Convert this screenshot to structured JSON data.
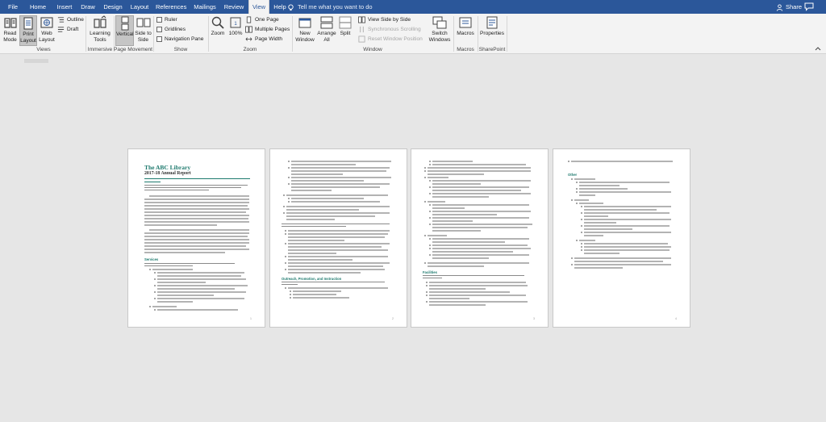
{
  "tabs": [
    {
      "label": "File",
      "active": false
    },
    {
      "label": "Home",
      "active": false
    },
    {
      "label": "Insert",
      "active": false
    },
    {
      "label": "Draw",
      "active": false
    },
    {
      "label": "Design",
      "active": false
    },
    {
      "label": "Layout",
      "active": false
    },
    {
      "label": "References",
      "active": false
    },
    {
      "label": "Mailings",
      "active": false
    },
    {
      "label": "Review",
      "active": false
    },
    {
      "label": "View",
      "active": true
    },
    {
      "label": "Help",
      "active": false
    }
  ],
  "tell_me": "Tell me what you want to do",
  "share_label": "Share",
  "ribbon": {
    "views": {
      "label": "Views",
      "read_mode": "Read Mode",
      "print_layout": "Print Layout",
      "web_layout": "Web Layout",
      "outline": "Outline",
      "draft": "Draft"
    },
    "immersive": {
      "label": "Immersive",
      "learning_tools": "Learning Tools"
    },
    "page_movement": {
      "label": "Page Movement",
      "vertical": "Vertical",
      "side_to_side": "Side to Side"
    },
    "show": {
      "label": "Show",
      "ruler": "Ruler",
      "gridlines": "Gridlines",
      "navigation_pane": "Navigation Pane"
    },
    "zoom": {
      "label": "Zoom",
      "zoom": "Zoom",
      "percent": "100%",
      "one_page": "One Page",
      "multiple_pages": "Multiple Pages",
      "page_width": "Page Width"
    },
    "window": {
      "label": "Window",
      "new_window": "New Window",
      "arrange_all": "Arrange All",
      "split": "Split",
      "view_side_by_side": "View Side by Side",
      "synchronous_scrolling": "Synchronous Scrolling",
      "reset_window_position": "Reset Window Position",
      "switch_windows": "Switch Windows"
    },
    "macros": {
      "label": "Macros",
      "macros": "Macros"
    },
    "sharepoint": {
      "label": "SharePoint",
      "properties": "Properties"
    }
  },
  "document": {
    "title": "The ABC Library",
    "subtitle": "2017-18 Annual Report",
    "section_services": "Services",
    "section_outreach": "Outreach, Promotion, and Instruction",
    "section_facilities": "Facilities",
    "section_other": "Other",
    "page_numbers": [
      "1",
      "2",
      "3",
      "4"
    ]
  },
  "colors": {
    "ribbon_blue": "#2b579a",
    "heading_teal": "#1e7a6e",
    "canvas": "#e6e6e6"
  }
}
